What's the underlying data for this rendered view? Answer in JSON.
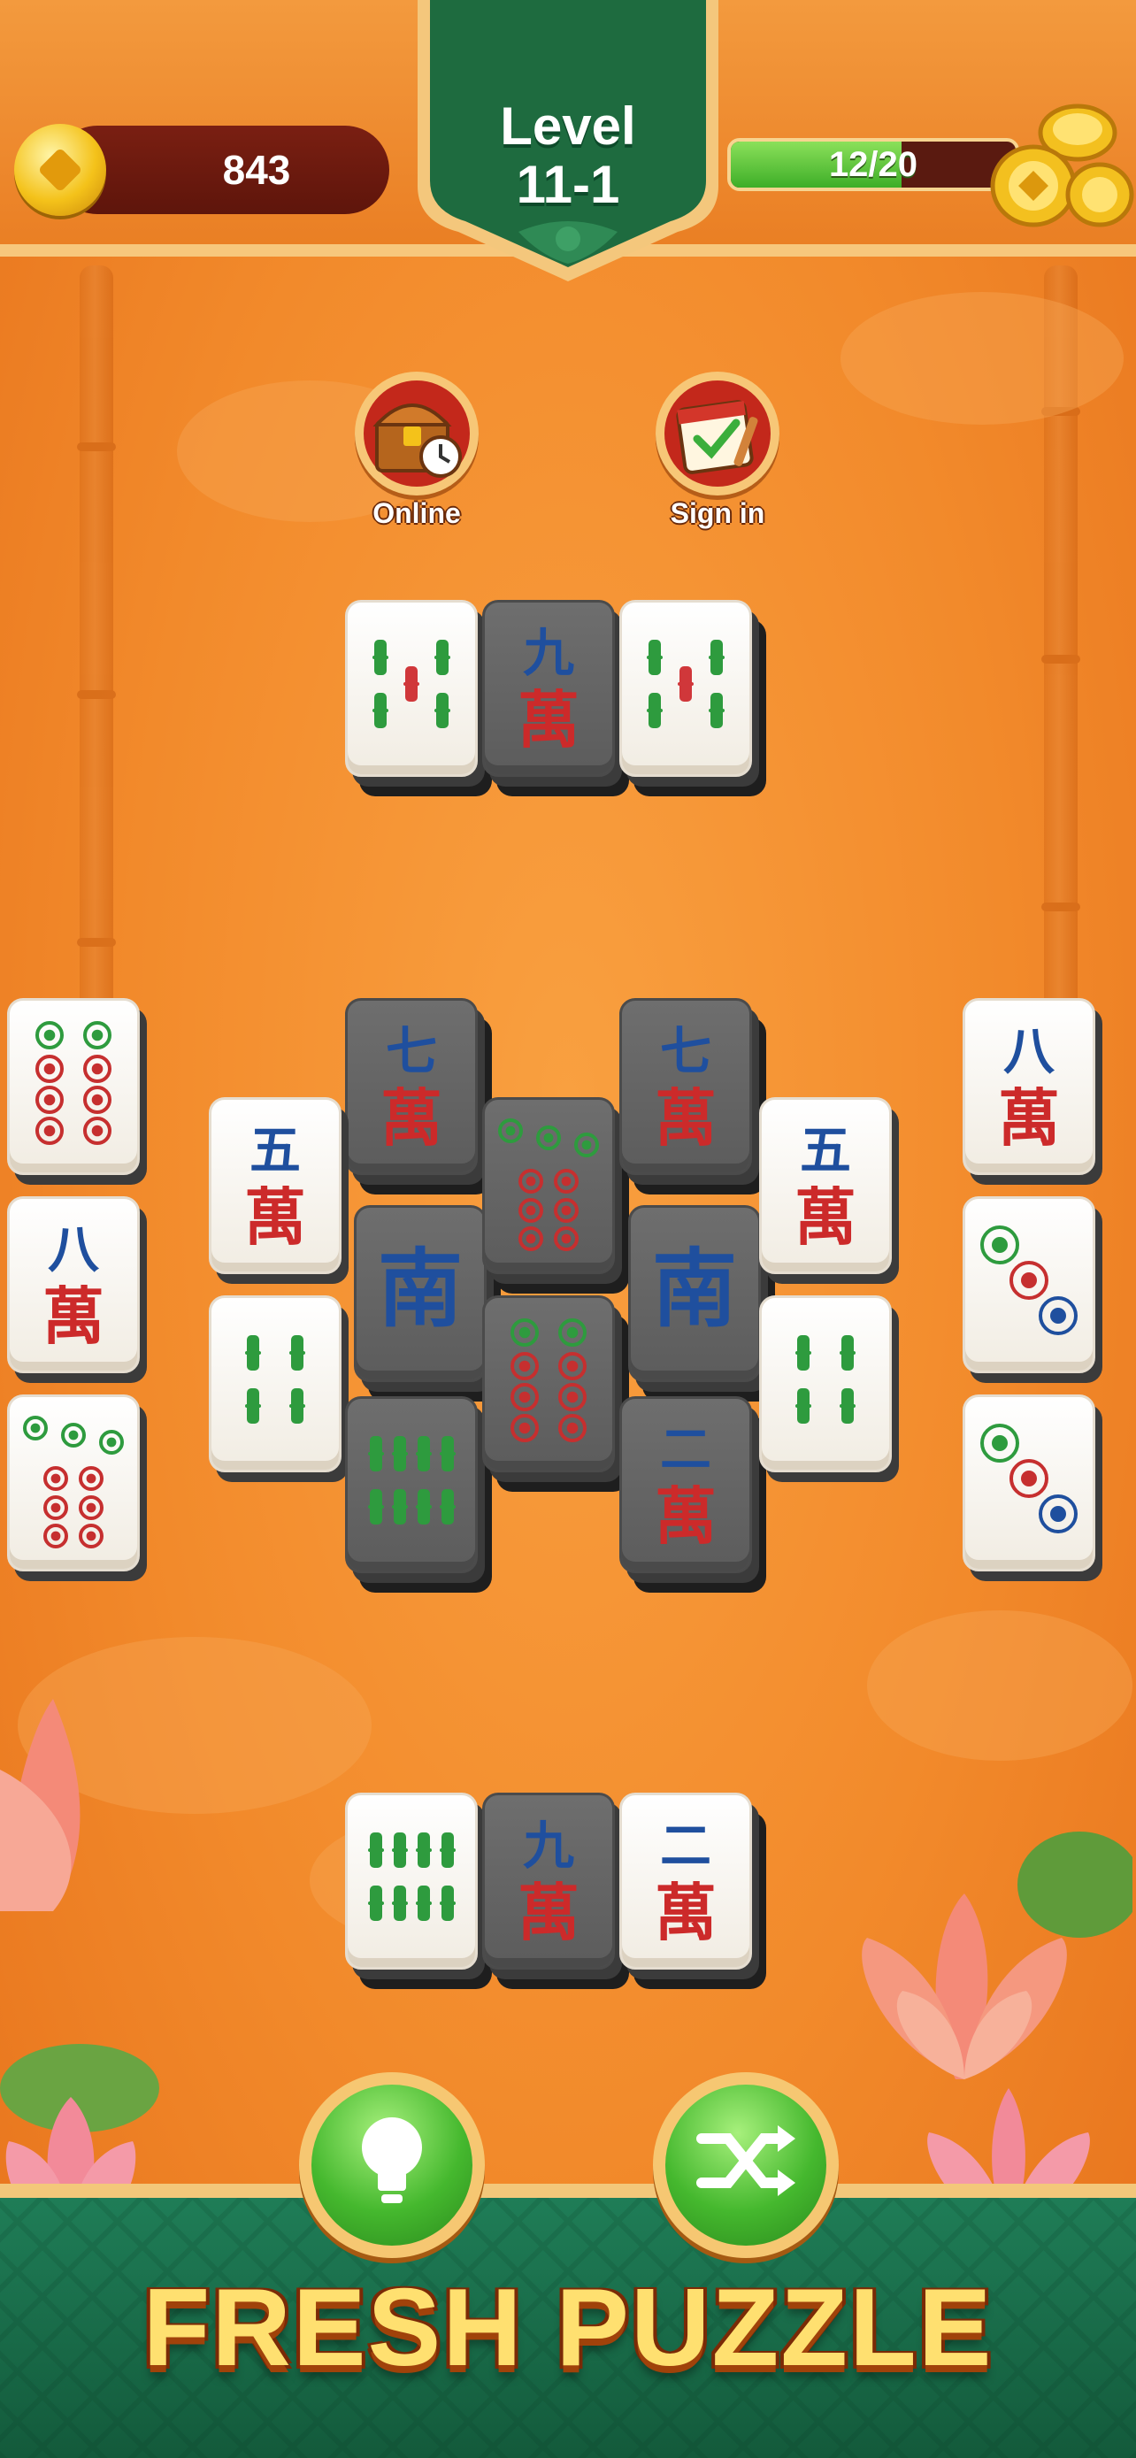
{
  "header": {
    "coins": "843",
    "level_line1": "Level",
    "level_line2": "11-1",
    "progress_text": "12/20",
    "progress_fraction": 0.6
  },
  "features": {
    "online_label": "Online",
    "signin_label": "Sign in"
  },
  "tiles": [
    {
      "id": "t01",
      "suit": "bamboo",
      "rank": 5,
      "dark": false,
      "layers": 2
    },
    {
      "id": "t02",
      "suit": "char",
      "rank": 9,
      "dark": true,
      "layers": 2
    },
    {
      "id": "t03",
      "suit": "bamboo",
      "rank": 5,
      "dark": false,
      "layers": 2
    },
    {
      "id": "t04",
      "suit": "circle",
      "rank": 8,
      "dark": false,
      "layers": 1
    },
    {
      "id": "t05",
      "suit": "char",
      "rank": 8,
      "dark": false,
      "layers": 1
    },
    {
      "id": "t06",
      "suit": "circle",
      "rank": 9,
      "dark": false,
      "layers": 1
    },
    {
      "id": "t07",
      "suit": "char",
      "rank": 7,
      "dark": true,
      "layers": 2
    },
    {
      "id": "t08",
      "suit": "char",
      "rank": 5,
      "dark": false,
      "layers": 1
    },
    {
      "id": "t09",
      "suit": "bamboo",
      "rank": 4,
      "dark": false,
      "layers": 1
    },
    {
      "id": "t10",
      "suit": "wind",
      "rank": 0,
      "dark": true,
      "layers": 2
    },
    {
      "id": "t11",
      "suit": "bamboo",
      "rank": 8,
      "dark": true,
      "layers": 2
    },
    {
      "id": "t12",
      "suit": "circle",
      "rank": 9,
      "dark": true,
      "layers": 2
    },
    {
      "id": "t13",
      "suit": "circle",
      "rank": 8,
      "dark": true,
      "layers": 2
    },
    {
      "id": "t14",
      "suit": "char",
      "rank": 7,
      "dark": true,
      "layers": 2
    },
    {
      "id": "t15",
      "suit": "wind",
      "rank": 0,
      "dark": true,
      "layers": 2
    },
    {
      "id": "t16",
      "suit": "char",
      "rank": 2,
      "dark": true,
      "layers": 2
    },
    {
      "id": "t17",
      "suit": "char",
      "rank": 5,
      "dark": false,
      "layers": 1
    },
    {
      "id": "t18",
      "suit": "bamboo",
      "rank": 4,
      "dark": false,
      "layers": 1
    },
    {
      "id": "t19",
      "suit": "char",
      "rank": 8,
      "dark": false,
      "layers": 1
    },
    {
      "id": "t20",
      "suit": "circle",
      "rank": 3,
      "dark": false,
      "layers": 1
    },
    {
      "id": "t21",
      "suit": "circle",
      "rank": 3,
      "dark": false,
      "layers": 1
    },
    {
      "id": "t22",
      "suit": "bamboo",
      "rank": 8,
      "dark": false,
      "layers": 2
    },
    {
      "id": "t23",
      "suit": "char",
      "rank": 9,
      "dark": true,
      "layers": 2
    },
    {
      "id": "t24",
      "suit": "char",
      "rank": 2,
      "dark": false,
      "layers": 2
    }
  ],
  "tile_glyphs": {
    "2": "二",
    "5": "五",
    "7": "七",
    "8": "八",
    "9": "九",
    "wan": "萬",
    "south": "南"
  },
  "colors": {
    "char_number": "#1f4f9e",
    "char_wan": "#cc2a2a",
    "bamboo_green": "#2e9b3e",
    "bamboo_red": "#d0373a",
    "circle_green": "#2e9b3e",
    "circle_red": "#c62f2f",
    "circle_blue": "#1f4f9e"
  },
  "buttons": {
    "hint": "lightbulb-icon",
    "shuffle": "shuffle-icon"
  },
  "tagline": "FRESH PUZZLE"
}
